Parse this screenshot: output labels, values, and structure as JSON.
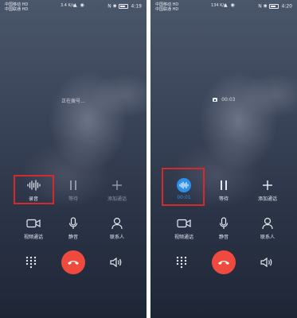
{
  "screens": [
    {
      "status": {
        "carrier_top": "中国移动 HD",
        "carrier_bottom": "中国联通 HD",
        "net_speed": "3.4 K/s",
        "time": "4:19"
      },
      "call_status": "正在拨号...",
      "record_timer": "",
      "record_label": "录音",
      "hold_label": "等待",
      "add_call_label": "添加通话",
      "video_call_label": "视频通话",
      "mute_label": "静音",
      "contacts_label": "联系人"
    },
    {
      "status": {
        "carrier_top": "中国移动 HD",
        "carrier_bottom": "中国联通 HD",
        "net_speed": "134 K/s",
        "time": "4:20"
      },
      "call_status": "00:03",
      "record_timer": "00:01",
      "record_label": "",
      "hold_label": "等待",
      "add_call_label": "添加通话",
      "video_call_label": "视频通话",
      "mute_label": "静音",
      "contacts_label": "联系人"
    }
  ],
  "colors": {
    "highlight": "#d42a2a",
    "hangup": "#f04a3e",
    "record_active": "#2c8fe8"
  },
  "icons": {
    "record": "waveform-icon",
    "hold": "pause-icon",
    "add_call": "plus-icon",
    "video_call": "video-camera-icon",
    "mute": "microphone-icon",
    "contacts": "person-icon",
    "keypad": "dialpad-icon",
    "hangup": "phone-hangup-icon",
    "speaker": "speaker-icon"
  }
}
